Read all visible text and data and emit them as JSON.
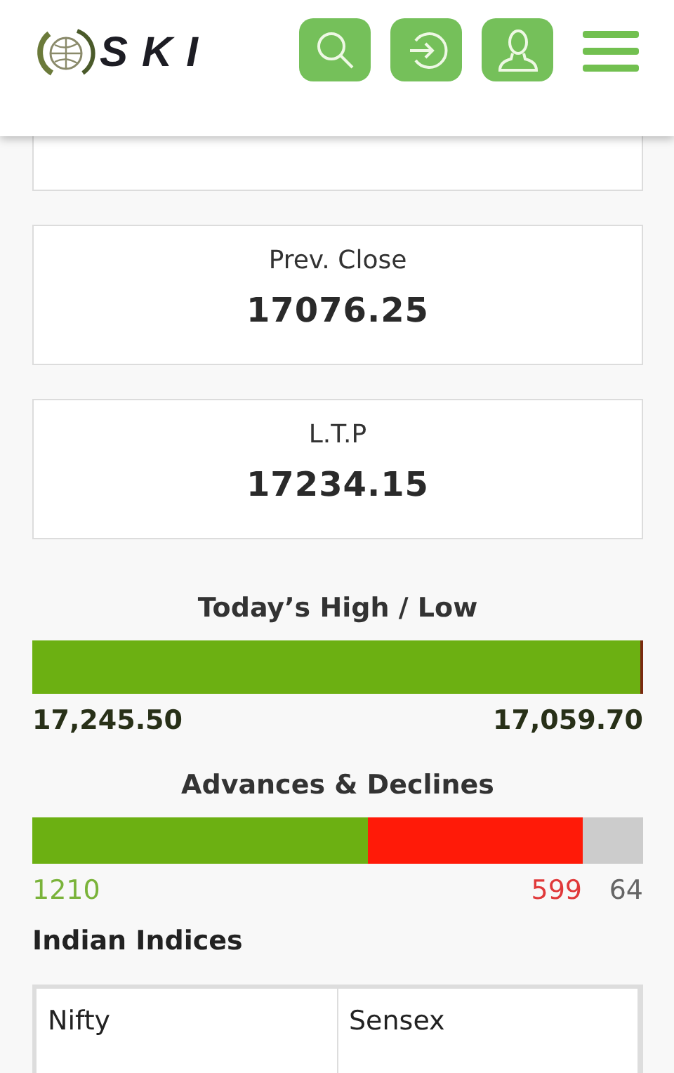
{
  "header": {
    "logo": "SKI",
    "buttons": [
      {
        "kind": "search"
      },
      {
        "kind": "login"
      },
      {
        "kind": "user"
      },
      {
        "kind": "menu"
      }
    ]
  },
  "cards": [
    {
      "label": "Prev. Close",
      "value": "17076.25"
    },
    {
      "label": "L.T.P",
      "value": "17234.15"
    }
  ],
  "high_low": {
    "title": "Today’s High / Low",
    "level": 0.996,
    "high": "17,245.50",
    "low": "17,059.70"
  },
  "advances_declines": {
    "title": "Advances & Declines",
    "advances": {
      "level": 0.55,
      "count": "1210"
    },
    "declines": {
      "level": 0.9,
      "count": "599"
    },
    "unchanged": {
      "count": "64"
    }
  },
  "indices": {
    "title": "Indian Indices",
    "columns": [
      "Nifty",
      "Sensex"
    ]
  }
}
